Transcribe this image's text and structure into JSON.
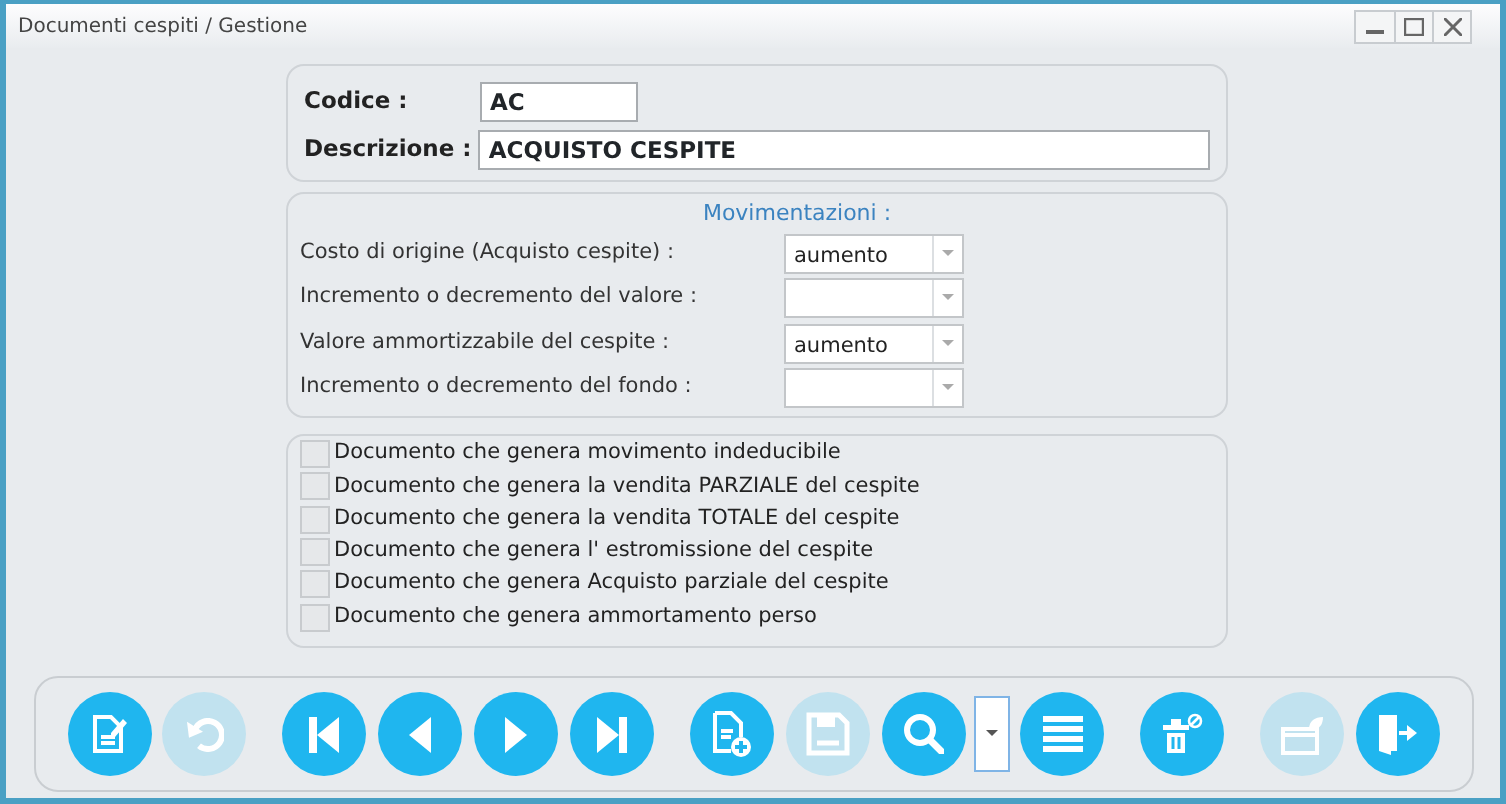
{
  "window": {
    "title": "Documenti cespiti / Gestione"
  },
  "header": {
    "fields": [
      {
        "label": "Codice :",
        "value": "AC",
        "kind": "short"
      },
      {
        "label": "Descrizione :",
        "value": "ACQUISTO CESPITE",
        "kind": "long"
      }
    ]
  },
  "movimentazioni": {
    "title": "Movimentazioni :",
    "rows": [
      {
        "label": "Costo di origine (Acquisto cespite) :",
        "value": "aumento"
      },
      {
        "label": "Incremento o decremento del valore :"
      },
      {
        "label": "Valore ammortizzabile del cespite :",
        "value": "aumento"
      },
      {
        "label": "Incremento o decremento del fondo :"
      }
    ]
  },
  "options": [
    {
      "label": "Documento che genera movimento indeducibile",
      "checked": false
    },
    {
      "label": "Documento che genera la vendita PARZIALE del cespite",
      "checked": false
    },
    {
      "label": "Documento che genera la vendita TOTALE del cespite",
      "checked": false
    },
    {
      "label": "Documento che genera l' estromissione del cespite",
      "checked": false
    },
    {
      "label": "Documento che genera Acquisto parziale del cespite",
      "checked": false
    },
    {
      "label": "Documento che genera ammortamento perso",
      "checked": false
    }
  ],
  "toolbar": [
    {
      "kind": "edit",
      "disabled": false
    },
    {
      "kind": "undo",
      "disabled": true
    },
    {
      "kind": "first",
      "disabled": false
    },
    {
      "kind": "prev",
      "disabled": false
    },
    {
      "kind": "next",
      "disabled": false
    },
    {
      "kind": "last",
      "disabled": false
    },
    {
      "kind": "new",
      "disabled": false
    },
    {
      "kind": "save",
      "disabled": true
    },
    {
      "kind": "search",
      "disabled": false
    },
    {
      "kind": "dropdown"
    },
    {
      "kind": "list",
      "disabled": false
    },
    {
      "kind": "delete",
      "disabled": false
    },
    {
      "kind": "card",
      "disabled": true
    },
    {
      "kind": "exit",
      "disabled": false
    }
  ]
}
